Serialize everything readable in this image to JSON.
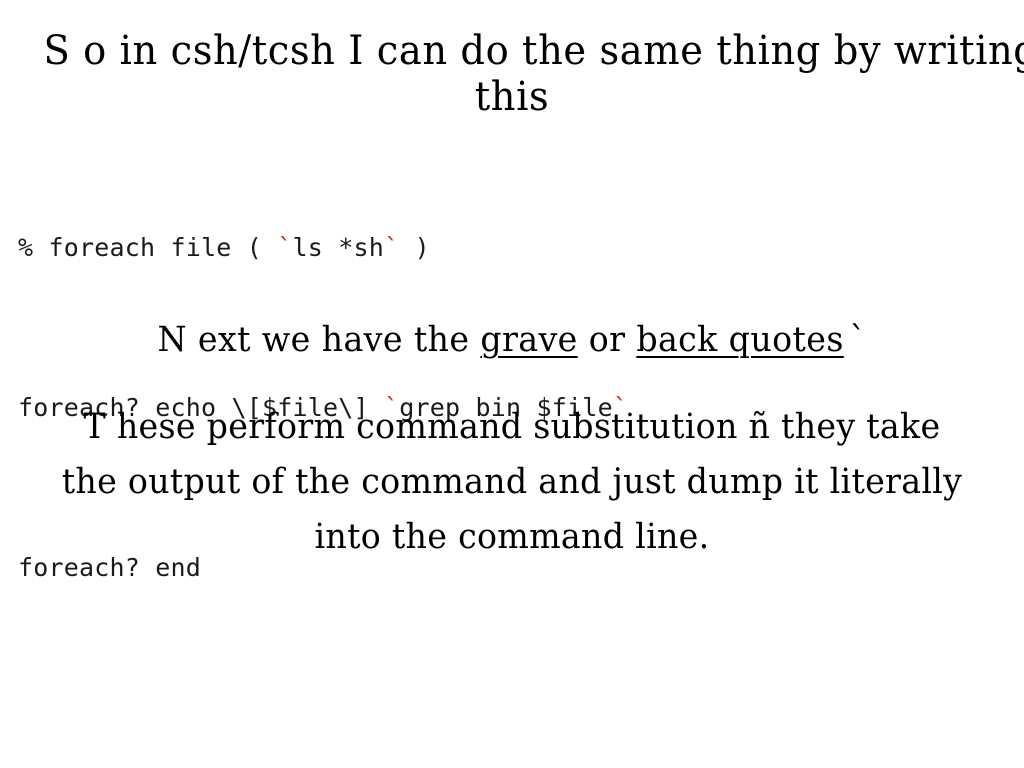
{
  "slide": {
    "background_color": "#ffffff",
    "text_color": "#000000",
    "accent_color": "#dd2222",
    "title": {
      "line1": "S o in csh/tcsh I can do the same thing by writing",
      "line2": "this"
    },
    "code_block": {
      "line1_part1": "% foreach file ( ",
      "line1_tick_open": "`",
      "line1_part2": "ls *sh",
      "line1_tick_close": "`",
      "line1_part3": " )",
      "line2_part1": "foreach? echo \\[$file\\] ",
      "line2_tick_open": "`",
      "line2_part2": "grep bin $file",
      "line2_tick_close": "`",
      "line3": "foreach? end"
    },
    "body": {
      "grave_line": {
        "prefix": "N ext we have the ",
        "term1": "grave",
        "conjunction": " or ",
        "term2": "back quotes",
        "backquote": "`"
      },
      "paragraph": {
        "line1": "T hese perform command substitution ñ they take",
        "line2": "the output of the command and just dump it literally",
        "line3": "into the command line."
      }
    }
  }
}
